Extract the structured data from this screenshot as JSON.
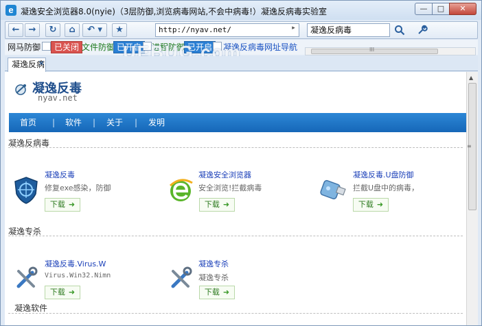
{
  "window": {
    "title": "凝逸安全浏览器8.0(nyie)（3层防御,浏览病毒网站,不会中病毒!）凝逸反病毒实验室",
    "minimize_label": "—",
    "maximize_label": "□",
    "close_label": "✕"
  },
  "toolbar": {
    "back_label": "←",
    "forward_label": "→",
    "refresh_label": "↻",
    "home_label": "⌂",
    "undo_label": "↶ ▾",
    "favorite_label": "★",
    "address_value": "http://nyav.net/",
    "go_label": "▸",
    "search_value": "凝逸反病毒",
    "search_icon": "🔍",
    "tools_icon": "🔧"
  },
  "plugin_bar": {
    "web_defense_label": "网马防御",
    "web_defense_status": "已关闭",
    "file_defense_label": "文件防御",
    "file_defense_status": "已开启",
    "process_defense_label": "进程防御",
    "process_defense_status": "已开启",
    "link_antivirus": "凝逸反病毒",
    "link_nav": "网址导航",
    "scroll_grip": "III"
  },
  "watermark": "UEBUG.com",
  "tabs": [
    {
      "label": "凝逸反病",
      "close": "✕"
    }
  ],
  "page": {
    "logo_title": "凝逸反毒",
    "logo_subtitle": "nyav.net",
    "menu": [
      "首页",
      "软件",
      "关于",
      "发明"
    ],
    "menu_separator": "|",
    "scrollbar_grip": "≡",
    "sections": [
      {
        "title": "凝逸反病毒",
        "items": [
          {
            "title": "凝逸反毒",
            "desc": "修复exe感染，防御",
            "download": "下载",
            "icon": "shield-icon"
          },
          {
            "title": "凝逸安全浏览器",
            "desc": "安全浏览!拦截病毒",
            "download": "下载",
            "icon": "browser-e-icon"
          },
          {
            "title": "凝逸反毒.U盘防御",
            "desc": "拦截U盘中的病毒，",
            "download": "下载",
            "icon": "usb-drive-icon"
          }
        ]
      },
      {
        "title": "凝逸专杀",
        "items": [
          {
            "title": "凝逸反毒.Virus.W",
            "desc": "Virus.Win32.Nimn",
            "download": "下载",
            "icon": "repair-tools-icon"
          },
          {
            "title": "凝逸专杀",
            "desc": "凝逸专杀",
            "download": "下载",
            "icon": "repair-tools-icon"
          }
        ]
      },
      {
        "title": "凝逸软件",
        "items": []
      }
    ],
    "download_arrow": "➜"
  },
  "colors": {
    "accent": "#1f72c4",
    "menu_bar": "#1a6fbf",
    "link": "#1a3fb8",
    "download_green": "#2d7a1f"
  }
}
